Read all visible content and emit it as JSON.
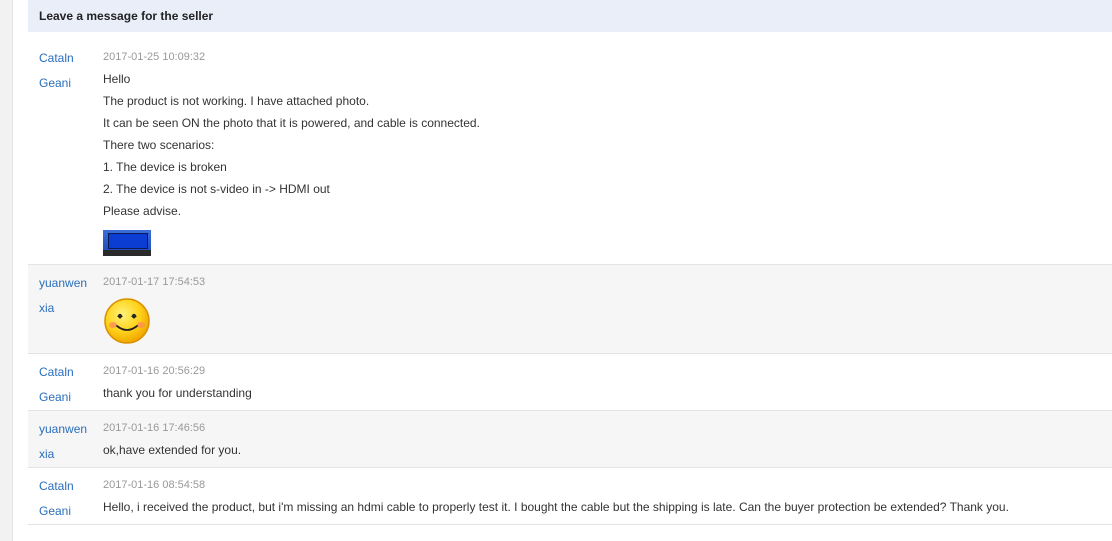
{
  "header": {
    "title": "Leave a message for the seller"
  },
  "messages": [
    {
      "author_line1": "Cataln",
      "author_line2": "Geani",
      "timestamp": "2017-01-25 10:09:32",
      "lines": [
        "Hello",
        "The product is not working. I have attached photo.",
        "It can be seen ON the photo that it is powered, and cable is connected.",
        "There two scenarios:",
        "1. The device is broken",
        "2. The device is not s-video in -> HDMI out",
        "Please advise."
      ],
      "attachment": "photo-thumbnail"
    },
    {
      "author_line1": "yuanwen",
      "author_line2": "xia",
      "timestamp": "2017-01-17 17:54:53",
      "emoji": "smiley-face-icon"
    },
    {
      "author_line1": "Cataln",
      "author_line2": "Geani",
      "timestamp": "2017-01-16 20:56:29",
      "lines": [
        "thank you for understanding"
      ]
    },
    {
      "author_line1": "yuanwen",
      "author_line2": "xia",
      "timestamp": "2017-01-16 17:46:56",
      "lines": [
        "ok,have extended for you."
      ]
    },
    {
      "author_line1": "Cataln",
      "author_line2": "Geani",
      "timestamp": "2017-01-16 08:54:58",
      "lines": [
        "Hello, i received the product, but i'm missing an hdmi cable to properly test it. I bought the cable but the shipping is late. Can the buyer protection be extended? Thank you."
      ]
    }
  ],
  "colors": {
    "header_bg": "#e9eef8",
    "author_link": "#2a6ebb",
    "timestamp": "#999999",
    "alt_row_bg": "#f6f6f6"
  }
}
